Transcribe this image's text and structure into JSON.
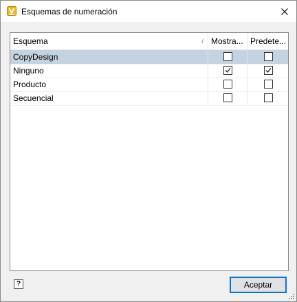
{
  "window": {
    "title": "Esquemas de numeración",
    "close_icon": "close-icon",
    "app_icon": "vault-app-icon"
  },
  "grid": {
    "columns": [
      {
        "label": "Esquema",
        "sorted": "ascending"
      },
      {
        "label": "Mostra..."
      },
      {
        "label": "Predete..."
      }
    ],
    "rows": [
      {
        "name": "CopyDesign",
        "mostrar": false,
        "predeterminado": false,
        "selected": true
      },
      {
        "name": "Ninguno",
        "mostrar": true,
        "predeterminado": true,
        "selected": false
      },
      {
        "name": "Producto",
        "mostrar": false,
        "predeterminado": false,
        "selected": false
      },
      {
        "name": "Secuencial",
        "mostrar": false,
        "predeterminado": false,
        "selected": false
      }
    ]
  },
  "footer": {
    "help_label": "?",
    "ok_label": "Aceptar"
  },
  "colors": {
    "selection": "#c3d3e2",
    "accent": "#0078d7",
    "app_icon": "#f3b414"
  }
}
